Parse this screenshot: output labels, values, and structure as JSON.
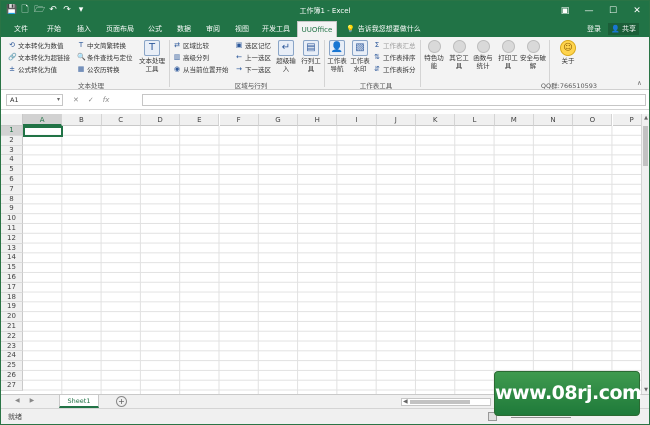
{
  "titlebar": {
    "title": "工作簿1 - Excel",
    "qat": [
      "💾",
      "🗋",
      "🗁",
      "↶",
      "↷",
      "▾"
    ],
    "window": {
      "restore": "▣",
      "minimize": "—",
      "maximize": "☐",
      "close": "✕"
    }
  },
  "tabs": [
    "文件",
    "开始",
    "插入",
    "页面布局",
    "公式",
    "数据",
    "审阅",
    "视图",
    "开发工具",
    "UUOffice"
  ],
  "active_tab": "UUOffice",
  "tell_me": "告诉我您想要做什么",
  "account": {
    "login": "登录",
    "share": "共享"
  },
  "ribbon": {
    "group1": {
      "label": "文本处理",
      "items": [
        "文本转化为数值",
        "文本转化为超链接",
        "公式转化为值",
        "中文简繁转换",
        "条件查找与定位",
        "公农历转换"
      ],
      "big": "文本处理工具"
    },
    "group2": {
      "label": "区域与行列",
      "items": [
        "区域比较",
        "高级分列",
        "从当前位置开始",
        "选区记忆",
        "上一选区",
        "下一选区"
      ],
      "big1": "超级输入",
      "big2": "行列工具"
    },
    "group3": {
      "label": "工作表工具",
      "big1": "工作表导航",
      "big2": "工作表水印",
      "items": [
        "工作表汇总",
        "工作表排序",
        "工作表拆分"
      ]
    },
    "group4": {
      "items": [
        "特色功能",
        "其它工具",
        "函数与统计",
        "打印工具",
        "安全与破解"
      ]
    },
    "about": {
      "label": "关于",
      "qq": "QQ群:766510593"
    }
  },
  "formula_bar": {
    "name_box": "A1",
    "cancel": "✕",
    "enter": "✓",
    "fx": "fx",
    "value": ""
  },
  "columns": [
    "A",
    "B",
    "C",
    "D",
    "E",
    "F",
    "G",
    "H",
    "I",
    "J",
    "K",
    "L",
    "M",
    "N",
    "O",
    "P"
  ],
  "rows": [
    "1",
    "2",
    "3",
    "4",
    "5",
    "6",
    "7",
    "8",
    "9",
    "10",
    "11",
    "12",
    "13",
    "14",
    "15",
    "16",
    "17",
    "18",
    "19",
    "20",
    "21",
    "22",
    "23",
    "24",
    "25",
    "26",
    "27"
  ],
  "active_cell": "A1",
  "sheets": [
    "Sheet1"
  ],
  "status": {
    "ready": "就绪"
  },
  "watermark": "www.08rj.com"
}
